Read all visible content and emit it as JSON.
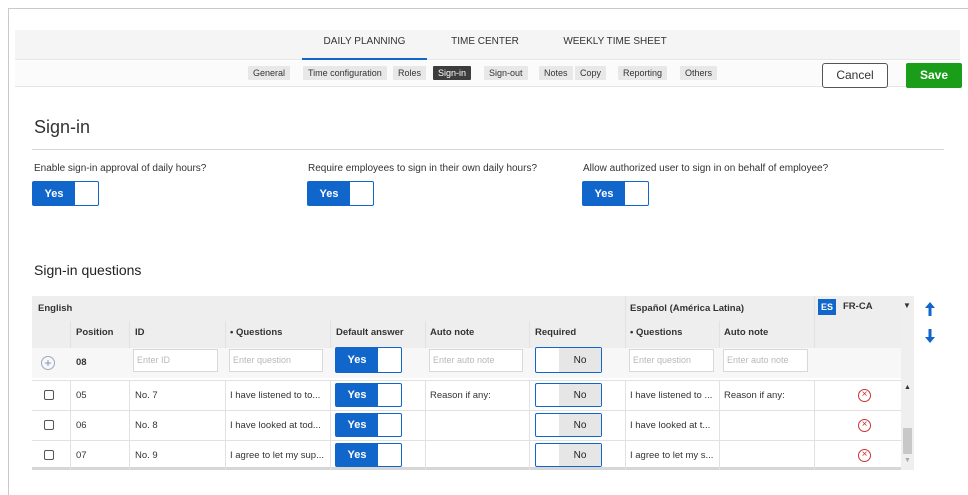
{
  "nav": {
    "tabs": [
      "DAILY PLANNING",
      "TIME CENTER",
      "WEEKLY TIME SHEET"
    ],
    "active_tab": "DAILY PLANNING"
  },
  "subnav": {
    "items": [
      "General",
      "Time configuration",
      "Roles",
      "Sign-in",
      "Sign-out",
      "Notes",
      "Copy",
      "Reporting",
      "Others"
    ],
    "active": "Sign-in"
  },
  "actions": {
    "cancel": "Cancel",
    "save": "Save"
  },
  "page": {
    "title": "Sign-in"
  },
  "settings": [
    {
      "label": "Enable sign-in approval of daily hours?",
      "value": "Yes"
    },
    {
      "label": "Require employees to sign in their own daily hours?",
      "value": "Yes"
    },
    {
      "label": "Allow authorized user to sign in on behalf of employee?",
      "value": "Yes"
    }
  ],
  "questions": {
    "section_title": "Sign-in questions",
    "group_english": "English",
    "group_spanish": "Español (América Latina)",
    "lang_es": "ES",
    "lang_frca": "FR-CA",
    "columns": {
      "position": "Position",
      "id": "ID",
      "questions": "• Questions",
      "default_answer": "Default answer",
      "auto_note": "Auto note",
      "required": "Required",
      "es_questions": "• Questions",
      "es_auto_note": "Auto note"
    },
    "new_row": {
      "position": "08",
      "id_placeholder": "Enter ID",
      "question_placeholder": "Enter question",
      "default_answer": "Yes",
      "auto_note_placeholder": "Enter auto note",
      "required": "No",
      "es_question_placeholder": "Enter question",
      "es_auto_note_placeholder": "Enter auto note"
    },
    "rows": [
      {
        "position": "05",
        "id": "No. 7",
        "question": "I have listened to to...",
        "default_answer": "Yes",
        "auto_note": "Reason if any:",
        "required": "No",
        "es_question": "I have listened to ...",
        "es_auto_note": "Reason if any:"
      },
      {
        "position": "06",
        "id": "No. 8",
        "question": "I have looked at tod...",
        "default_answer": "Yes",
        "auto_note": "",
        "required": "No",
        "es_question": "I have looked at t...",
        "es_auto_note": ""
      },
      {
        "position": "07",
        "id": "No. 9",
        "question": "I agree to let my sup...",
        "default_answer": "Yes",
        "auto_note": "",
        "required": "No",
        "es_question": "I agree to let my s...",
        "es_auto_note": ""
      }
    ]
  },
  "colors": {
    "accent": "#1166cc",
    "save": "#1a9e1a",
    "remove": "#cc3333"
  }
}
